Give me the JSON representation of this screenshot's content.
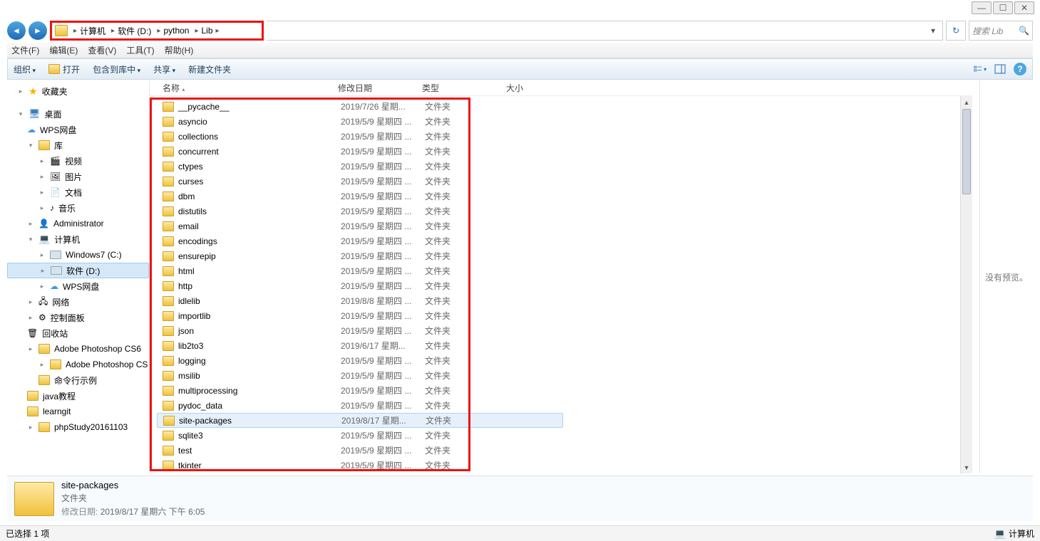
{
  "window_controls": {
    "min": "—",
    "max": "☐",
    "close": "✕"
  },
  "breadcrumb": {
    "seg1": "计算机",
    "seg2": "软件 (D:)",
    "seg3": "python",
    "seg4": "Lib"
  },
  "refresh_icon": "↻",
  "search": {
    "placeholder": "搜索 Lib",
    "icon": "🔍"
  },
  "menubar": {
    "m1": "文件(F)",
    "m2": "编辑(E)",
    "m3": "查看(V)",
    "m4": "工具(T)",
    "m5": "帮助(H)"
  },
  "toolbar": {
    "organize": "组织",
    "open": "打开",
    "include": "包含到库中",
    "share": "共享",
    "newfolder": "新建文件夹",
    "help_icon": "?"
  },
  "nav": {
    "favorites": "收藏夹",
    "desktop": "桌面",
    "wps": "WPS网盘",
    "libraries": "库",
    "videos": "视频",
    "pictures": "图片",
    "documents": "文档",
    "music": "音乐",
    "admin": "Administrator",
    "computer": "计算机",
    "win7": "Windows7 (C:)",
    "soft": "软件 (D:)",
    "wps2": "WPS网盘",
    "network": "网络",
    "cpanel": "控制面板",
    "recycle": "回收站",
    "ps1": "Adobe Photoshop CS6",
    "ps2": "Adobe Photoshop CS",
    "cmd": "命令行示例",
    "java": "java教程",
    "learngit": "learngit",
    "phpstudy": "phpStudy20161103"
  },
  "columns": {
    "name": "名称",
    "date": "修改日期",
    "type": "类型",
    "size": "大小"
  },
  "files": [
    {
      "name": "__pycache__",
      "date": "2019/7/26 星期...",
      "type": "文件夹"
    },
    {
      "name": "asyncio",
      "date": "2019/5/9 星期四 ...",
      "type": "文件夹"
    },
    {
      "name": "collections",
      "date": "2019/5/9 星期四 ...",
      "type": "文件夹"
    },
    {
      "name": "concurrent",
      "date": "2019/5/9 星期四 ...",
      "type": "文件夹"
    },
    {
      "name": "ctypes",
      "date": "2019/5/9 星期四 ...",
      "type": "文件夹"
    },
    {
      "name": "curses",
      "date": "2019/5/9 星期四 ...",
      "type": "文件夹"
    },
    {
      "name": "dbm",
      "date": "2019/5/9 星期四 ...",
      "type": "文件夹"
    },
    {
      "name": "distutils",
      "date": "2019/5/9 星期四 ...",
      "type": "文件夹"
    },
    {
      "name": "email",
      "date": "2019/5/9 星期四 ...",
      "type": "文件夹"
    },
    {
      "name": "encodings",
      "date": "2019/5/9 星期四 ...",
      "type": "文件夹"
    },
    {
      "name": "ensurepip",
      "date": "2019/5/9 星期四 ...",
      "type": "文件夹"
    },
    {
      "name": "html",
      "date": "2019/5/9 星期四 ...",
      "type": "文件夹"
    },
    {
      "name": "http",
      "date": "2019/5/9 星期四 ...",
      "type": "文件夹"
    },
    {
      "name": "idlelib",
      "date": "2019/8/8 星期四 ...",
      "type": "文件夹"
    },
    {
      "name": "importlib",
      "date": "2019/5/9 星期四 ...",
      "type": "文件夹"
    },
    {
      "name": "json",
      "date": "2019/5/9 星期四 ...",
      "type": "文件夹"
    },
    {
      "name": "lib2to3",
      "date": "2019/6/17 星期...",
      "type": "文件夹"
    },
    {
      "name": "logging",
      "date": "2019/5/9 星期四 ...",
      "type": "文件夹"
    },
    {
      "name": "msilib",
      "date": "2019/5/9 星期四 ...",
      "type": "文件夹"
    },
    {
      "name": "multiprocessing",
      "date": "2019/5/9 星期四 ...",
      "type": "文件夹"
    },
    {
      "name": "pydoc_data",
      "date": "2019/5/9 星期四 ...",
      "type": "文件夹"
    },
    {
      "name": "site-packages",
      "date": "2019/8/17 星期...",
      "type": "文件夹",
      "selected": true
    },
    {
      "name": "sqlite3",
      "date": "2019/5/9 星期四 ...",
      "type": "文件夹"
    },
    {
      "name": "test",
      "date": "2019/5/9 星期四 ...",
      "type": "文件夹"
    },
    {
      "name": "tkinter",
      "date": "2019/5/9 星期四 ...",
      "type": "文件夹"
    }
  ],
  "preview_text": "没有预览。",
  "details": {
    "title": "site-packages",
    "type": "文件夹",
    "date_label": "修改日期:",
    "date_value": "2019/8/17 星期六 下午 6:05"
  },
  "status": {
    "left": "已选择 1 项",
    "right": "计算机"
  }
}
